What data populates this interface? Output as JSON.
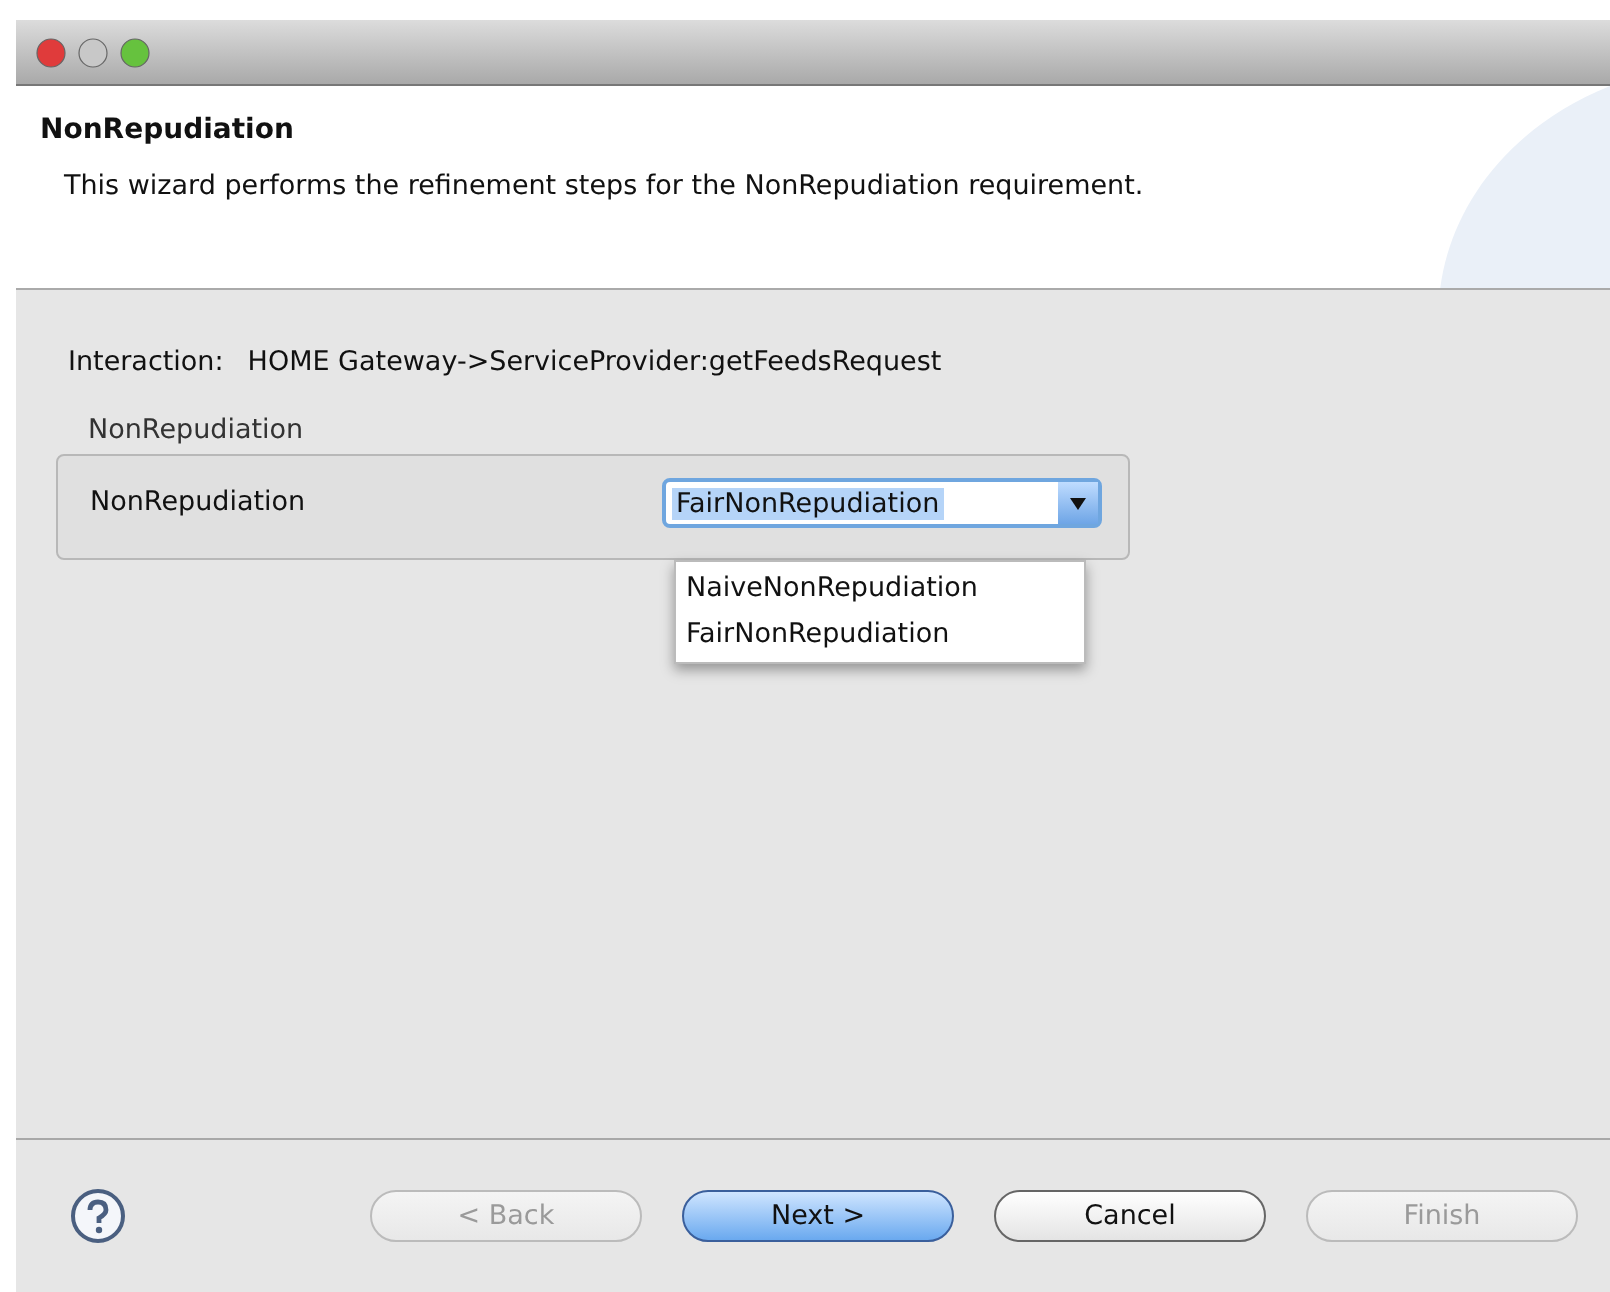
{
  "header": {
    "title": "NonRepudiation",
    "description": "This wizard performs the refinement steps for the NonRepudiation requirement."
  },
  "interaction": {
    "label": "Interaction:",
    "value": "HOME Gateway->ServiceProvider:getFeedsRequest"
  },
  "group": {
    "title": "NonRepudiation",
    "field_label": "NonRepudiation",
    "combo": {
      "value": "FairNonRepudiation",
      "expanded": true,
      "options": [
        "NaiveNonRepudiation",
        "FairNonRepudiation"
      ]
    }
  },
  "buttons": [
    {
      "label": "< Back",
      "disabled": true,
      "default": false
    },
    {
      "label": "Next >",
      "disabled": false,
      "default": true
    },
    {
      "label": "Cancel",
      "disabled": false,
      "default": false
    },
    {
      "label": "Finish",
      "disabled": true,
      "default": false
    }
  ]
}
